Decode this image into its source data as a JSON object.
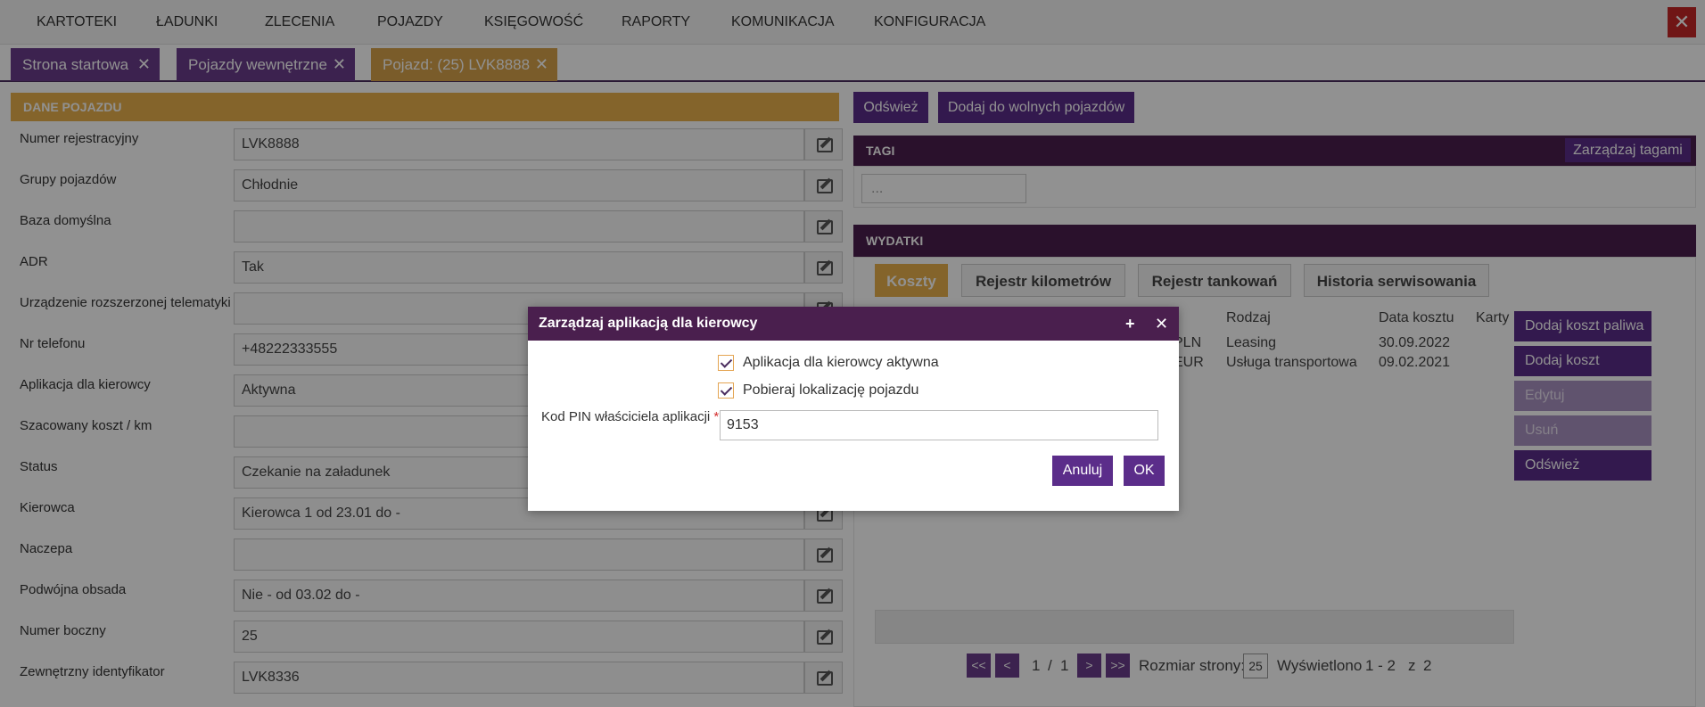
{
  "topmenu": {
    "items": [
      "KARTOTEKI",
      "ŁADUNKI",
      "ZLECENIA",
      "POJAZDY",
      "KSIĘGOWOŚĆ",
      "RAPORTY",
      "KOMUNIKACJA",
      "KONFIGURACJA"
    ],
    "close_glyph": "✕"
  },
  "tabs": [
    {
      "label": "Strona startowa",
      "close": "✕"
    },
    {
      "label": "Pojazdy wewnętrzne",
      "close": "✕"
    },
    {
      "label": "Pojazd: (25) LVK8888",
      "close": "✕"
    }
  ],
  "left_panel": {
    "title": "DANE POJAZDU",
    "rows": [
      {
        "label": "Numer rejestracyjny",
        "value": "LVK8888"
      },
      {
        "label": "Grupy pojazdów",
        "value": "Chłodnie"
      },
      {
        "label": "Baza domyślna",
        "value": ""
      },
      {
        "label": "ADR",
        "value": "Tak"
      },
      {
        "label": "Urządzenie rozszerzonej telematyki",
        "value": ""
      },
      {
        "label": "Nr telefonu",
        "value": "+48222333555"
      },
      {
        "label": "Aplikacja dla kierowcy",
        "value": "Aktywna"
      },
      {
        "label": "Szacowany koszt / km",
        "value": ""
      },
      {
        "label": "Status",
        "value": "Czekanie na załadunek"
      },
      {
        "label": "Kierowca",
        "value": "Kierowca 1 od 23.01 do  -"
      },
      {
        "label": "Naczepa",
        "value": ""
      },
      {
        "label": "Podwójna obsada",
        "value": "Nie -  od 03.02 do  -"
      },
      {
        "label": "Numer boczny",
        "value": "25"
      },
      {
        "label": "Zewnętrzny identyfikator",
        "value": "LVK8336"
      }
    ]
  },
  "right_toolbar": {
    "refresh": "Odśwież",
    "add_free": "Dodaj do wolnych pojazdów"
  },
  "tags": {
    "title": "TAGI",
    "manage": "Zarządzaj tagami",
    "input_placeholder": "..."
  },
  "expenses": {
    "title": "WYDATKI",
    "subtabs": [
      "Koszty",
      "Rejestr kilometrów",
      "Rejestr tankowań",
      "Historia serwisowania"
    ],
    "columns": [
      "Rodzaj",
      "Data kosztu",
      "Karty"
    ],
    "rows": [
      {
        "currency": "PLN",
        "type": "Leasing",
        "date": "30.09.2022"
      },
      {
        "currency": "EUR",
        "type": "Usługa transportowa",
        "date": "09.02.2021"
      }
    ],
    "actions": {
      "add_fuel": "Dodaj koszt paliwa",
      "add_cost": "Dodaj koszt",
      "edit": "Edytuj",
      "delete": "Usuń",
      "refresh": "Odśwież"
    },
    "pager": {
      "first": "<<",
      "prev": "<",
      "page": "1",
      "sep": "/",
      "total": "1",
      "next": ">",
      "last": ">>",
      "size_label": "Rozmiar strony:",
      "size_value": "25",
      "shown_label": "Wyświetlono",
      "range": "1 - 2",
      "of": "z",
      "count": "2"
    }
  },
  "dialog": {
    "title": "Zarządzaj aplikacją dla kierowcy",
    "maximize": "+",
    "close": "✕",
    "check_active": "Aplikacja dla kierowcy aktywna",
    "check_location": "Pobieraj lokalizację pojazdu",
    "pin_label": "Kod PIN właściciela aplikacji",
    "required_mark": "*",
    "pin_value": "9153",
    "cancel": "Anuluj",
    "ok": "OK"
  },
  "colors": {
    "plum": "#4a1f4e",
    "purple": "#5b2d8a",
    "gold": "#e8b14c",
    "red": "#c62828"
  }
}
